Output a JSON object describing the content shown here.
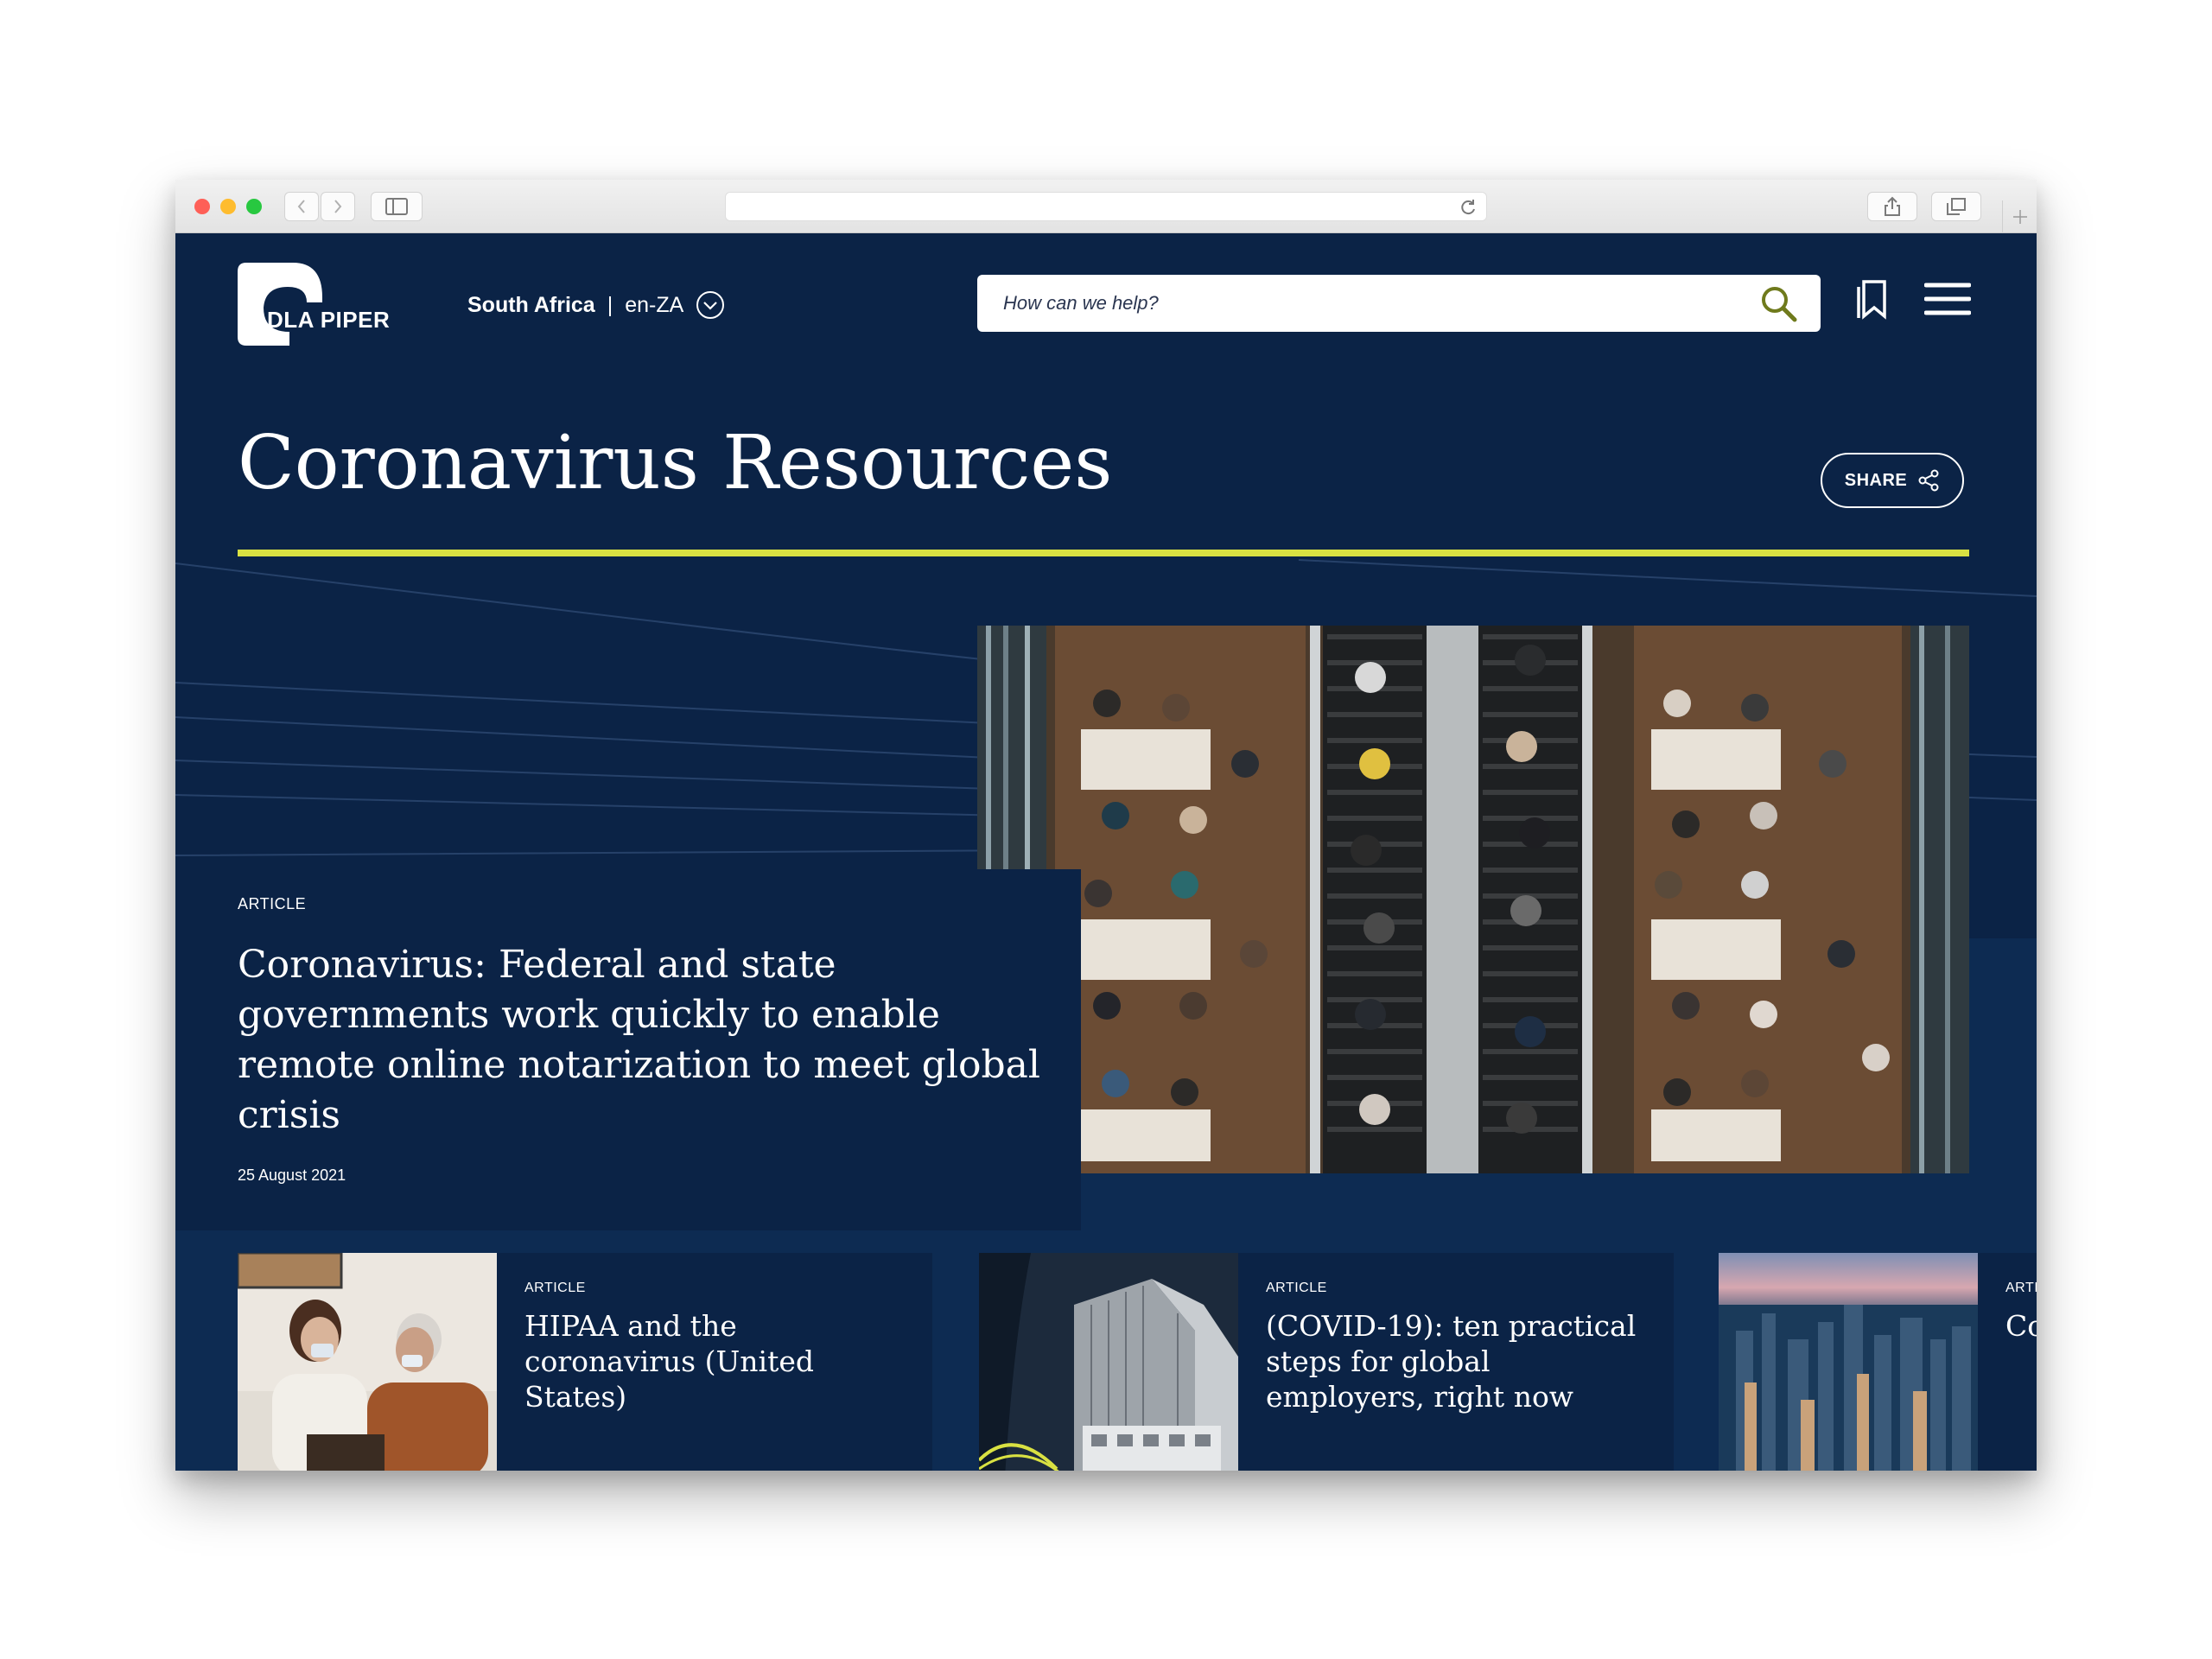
{
  "browser": {
    "address": ""
  },
  "header": {
    "logo_text": "DLA PIPER",
    "region": {
      "country": "South Africa",
      "separator": "|",
      "language": "en-ZA"
    },
    "search": {
      "placeholder": "How can we help?"
    }
  },
  "main": {
    "title": "Coronavirus Resources",
    "share_label": "SHARE",
    "featured": {
      "type": "ARTICLE",
      "headline": "Coronavirus: Federal and state governments work quickly to enable remote online notarization to meet global crisis",
      "date": "25 August 2021"
    },
    "cards": [
      {
        "type": "ARTICLE",
        "title": "HIPAA and the coronavirus (United States)"
      },
      {
        "type": "ARTICLE",
        "title": "(COVID-19): ten practical steps for global employers, right now"
      },
      {
        "type": "ARTI",
        "title": "Co W"
      }
    ]
  },
  "colors": {
    "navy": "#0b2346",
    "band": "#0d2b52",
    "accent_rule": "#d9e142"
  }
}
